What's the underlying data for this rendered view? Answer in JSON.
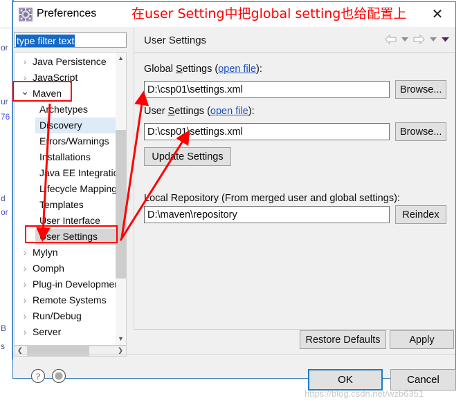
{
  "window": {
    "title": "Preferences",
    "icon": "gear-icon",
    "close_label": "✕"
  },
  "annotation": {
    "title_note": "在user Setting中把global setting也给配置上",
    "color": "#fe0000",
    "boxes": [
      "Maven",
      "User Settings"
    ]
  },
  "filter": {
    "value": "type filter text",
    "placeholder": "type filter text"
  },
  "tree": {
    "items": [
      {
        "label": "Java Persistence",
        "indent": 0,
        "arrow": "collapsed",
        "state": "none"
      },
      {
        "label": "JavaScript",
        "indent": 0,
        "arrow": "collapsed",
        "state": "none"
      },
      {
        "label": "Maven",
        "indent": 0,
        "arrow": "expanded",
        "state": "none"
      },
      {
        "label": "Archetypes",
        "indent": 1,
        "arrow": "none",
        "state": "none"
      },
      {
        "label": "Discovery",
        "indent": 1,
        "arrow": "none",
        "state": "hover"
      },
      {
        "label": "Errors/Warnings",
        "indent": 1,
        "arrow": "none",
        "state": "none"
      },
      {
        "label": "Installations",
        "indent": 1,
        "arrow": "none",
        "state": "none"
      },
      {
        "label": "Java EE Integration",
        "indent": 1,
        "arrow": "none",
        "state": "none"
      },
      {
        "label": "Lifecycle Mappings",
        "indent": 1,
        "arrow": "none",
        "state": "none"
      },
      {
        "label": "Templates",
        "indent": 1,
        "arrow": "none",
        "state": "none"
      },
      {
        "label": "User Interface",
        "indent": 1,
        "arrow": "none",
        "state": "none"
      },
      {
        "label": "User Settings",
        "indent": 1,
        "arrow": "none",
        "state": "selected"
      },
      {
        "label": "Mylyn",
        "indent": 0,
        "arrow": "collapsed",
        "state": "none"
      },
      {
        "label": "Oomph",
        "indent": 0,
        "arrow": "collapsed",
        "state": "none"
      },
      {
        "label": "Plug-in Development",
        "indent": 0,
        "arrow": "collapsed",
        "state": "none"
      },
      {
        "label": "Remote Systems",
        "indent": 0,
        "arrow": "collapsed",
        "state": "none"
      },
      {
        "label": "Run/Debug",
        "indent": 0,
        "arrow": "collapsed",
        "state": "none"
      },
      {
        "label": "Server",
        "indent": 0,
        "arrow": "collapsed",
        "state": "none"
      }
    ]
  },
  "panel": {
    "title": "User Settings",
    "nav": {
      "back": "back-arrow",
      "back_menu": "chevron-down",
      "forward": "forward-arrow",
      "forward_menu": "chevron-down",
      "view_menu": "chevron-down"
    },
    "global_settings": {
      "label_pre": "Global ",
      "label_acc": "S",
      "label_post": "ettings (",
      "link": "open file",
      "label_end": "):",
      "value": "D:\\csp01\\settings.xml",
      "browse": "Browse..."
    },
    "user_settings": {
      "label_pre": "User ",
      "label_acc": "S",
      "label_post": "ettings (",
      "link": "open file",
      "label_end": "):",
      "value": "D:\\csp01\\settings.xml",
      "browse": "Browse..."
    },
    "update_button": "Update Settings",
    "local_repository": {
      "label": "Local Repository (From merged user and global settings):",
      "value": "D:\\maven\\repository",
      "reindex": "Reindex"
    },
    "restore_defaults": "Restore Defaults",
    "apply": "Apply"
  },
  "footer": {
    "help_icon": "question-mark-icon",
    "secondary_icon": "circle-icon",
    "ok": "OK",
    "cancel": "Cancel"
  },
  "watermark": "https://blog.csdn.net/wzb6351",
  "background_editor": {
    "lines": [
      "or",
      "ur",
      "76",
      "d",
      "or",
      "B",
      "s"
    ]
  }
}
